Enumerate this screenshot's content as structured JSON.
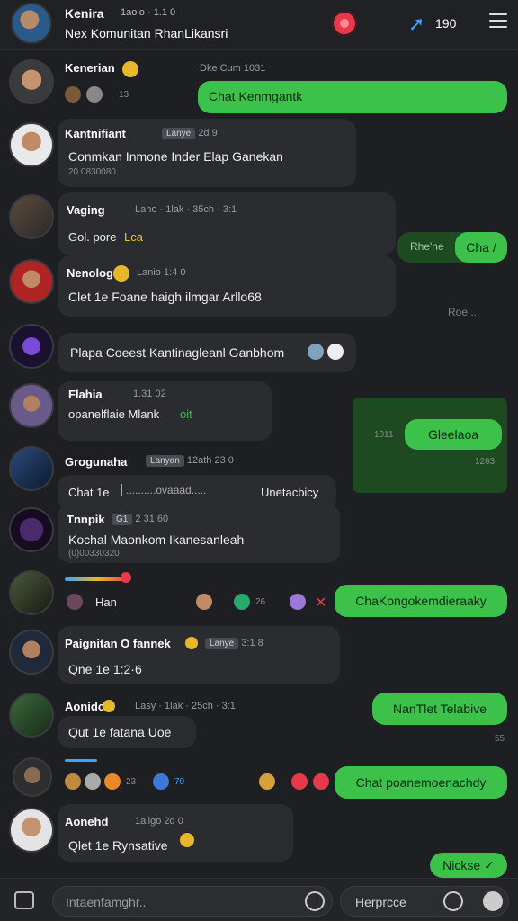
{
  "header": {
    "title": "Kenira",
    "meta": "1aoio · 1.1 0",
    "subtitle": "Nex  Komunitan  RhanLikansri",
    "count": "190"
  },
  "messages": [
    {
      "name": "Kenerian",
      "meta": "Dke      Cum       1031",
      "reactions_count": "13",
      "green_text": "Chat Kenmgantk"
    },
    {
      "name": "Kantnifiant",
      "badge": "Lanye",
      "meta": "2d 9",
      "text": "Conmkan Inmone Inder  Elap Ganekan",
      "sub": "20 0830080"
    },
    {
      "name": "Vaging",
      "meta": "Lano · 1lak · 35ch · 3:1",
      "text": "Gol. pore",
      "tag": "Lca",
      "green_text": "Cha /",
      "green_prefix": "Rhe'ne"
    },
    {
      "name": "Nenolog",
      "meta": "Lanio    1:4 0",
      "text": "Clet 1e   Foane haigh ilmgar Arllo68",
      "right_dim": "Roe ..."
    },
    {
      "text": "Plapa Coeest Kantinagleanl Ganbhom"
    },
    {
      "name": "Flahia",
      "meta": "1.31 02",
      "text": "opanelflaie Mlank",
      "tag": "oit",
      "green_text": "Gleelaoa",
      "green_meta_left": "1011",
      "green_meta_right": "1263"
    },
    {
      "name": "Grogunaha",
      "badge": "Lanyan",
      "meta": "12ath   23 0",
      "text": "Chat 1e",
      "text2": "..........ovaaad.....",
      "bubble_text": "Unetacbicy"
    },
    {
      "name": "Tnnpik",
      "badge2": "G1",
      "meta": "2 31 60",
      "text": "Kochal Maonkom Ikanesanleah",
      "sub": "(0)00330320"
    },
    {
      "text": "Han",
      "green_text": "ChaKongokemdieraaky",
      "reactions_count": "26"
    },
    {
      "name": "Paignitan O fannek",
      "badge": "Lanye",
      "meta": "3:1 8",
      "text": "Qne 1e   1:2·6"
    },
    {
      "name": "Aonidc",
      "meta": "Lasy · 1lak · 25ch · 3:1",
      "text": "Qut 1e   fatana Uoe",
      "green_text": "NanTlet Telabive",
      "dim": "55"
    },
    {
      "reactions_count": "23",
      "reactions_count2": "70",
      "green_text": "Chat poanemoenachdy"
    },
    {
      "name": "Aonehd",
      "meta": "1aiigo   2d 0",
      "text": "Qlet 1e   Rynsative",
      "green_text": "Nickse"
    }
  ],
  "composer": {
    "placeholder": "Intaenfamghr..",
    "reply_label": "Herprcce"
  },
  "colors": {
    "background": "#1e1f22",
    "bubble": "#2b2c30",
    "accent_green": "#3cc14b",
    "record_red": "#e8394a",
    "share_blue": "#3da3ff"
  },
  "icons": [
    "record-icon",
    "share-icon",
    "menu-icon",
    "attach-icon",
    "send-icon",
    "camera-icon",
    "info-icon"
  ]
}
